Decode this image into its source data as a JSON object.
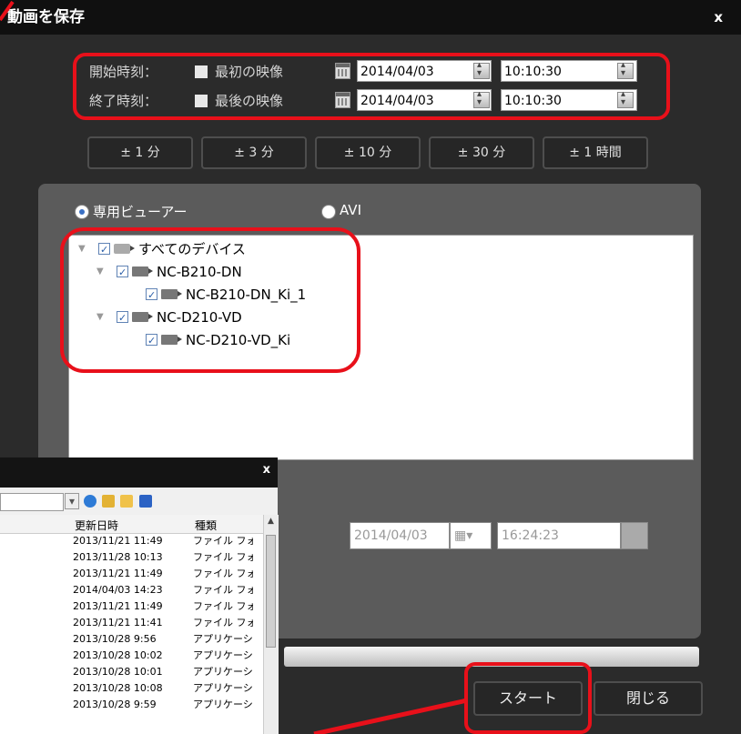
{
  "dialog": {
    "title": "動画を保存",
    "close": "x"
  },
  "time": {
    "start": {
      "label": "開始時刻：",
      "first_label": "最初の映像",
      "date": "2014/04/03",
      "time": "10:10:30"
    },
    "end": {
      "label": "終了時刻：",
      "last_label": "最後の映像",
      "date": "2014/04/03",
      "time": "10:10:30"
    }
  },
  "adjust_buttons": [
    "± 1 分",
    "± 3 分",
    "± 10 分",
    "± 30 分",
    "± 1 時間"
  ],
  "format": {
    "dedicated_viewer": "専用ビューアー",
    "avi": "AVI",
    "selected": "dedicated_viewer"
  },
  "tree": [
    {
      "label": "すべてのデバイス",
      "level": 0,
      "type": "disk",
      "expanded": true
    },
    {
      "label": "NC-B210-DN",
      "level": 1,
      "type": "camera",
      "expanded": true
    },
    {
      "label": "NC-B210-DN_Ki_1",
      "level": 2,
      "type": "camera"
    },
    {
      "label": "NC-D210-VD",
      "level": 1,
      "type": "camera",
      "expanded": true
    },
    {
      "label": "NC-D210-VD_Ki",
      "level": 2,
      "type": "camera"
    }
  ],
  "lower": {
    "date": "2014/04/03",
    "time": "16:24:23"
  },
  "buttons": {
    "start": "スタート",
    "close": "閉じる"
  },
  "file_window": {
    "close": "x",
    "columns": {
      "modified": "更新日時",
      "kind": "種類"
    },
    "rows": [
      {
        "date": "2013/11/21 11:49",
        "kind": "ファイル フォル"
      },
      {
        "date": "2013/11/28 10:13",
        "kind": "ファイル フォル"
      },
      {
        "date": "2013/11/21 11:49",
        "kind": "ファイル フォル"
      },
      {
        "date": "2014/04/03 14:23",
        "kind": "ファイル フォル"
      },
      {
        "date": "2013/11/21 11:49",
        "kind": "ファイル フォル"
      },
      {
        "date": "2013/11/21 11:41",
        "kind": "ファイル フォル"
      },
      {
        "date": "2013/10/28 9:56",
        "kind": "アプリケーショ"
      },
      {
        "date": "2013/10/28 10:02",
        "kind": "アプリケーショ"
      },
      {
        "date": "2013/10/28 10:01",
        "kind": "アプリケーショ"
      },
      {
        "date": "2013/10/28 10:08",
        "kind": "アプリケーショ"
      },
      {
        "date": "2013/10/28 9:59",
        "kind": "アプリケーショ"
      }
    ]
  },
  "colors": {
    "highlight": "#e8101a",
    "dialog_bg": "#2b2b2b",
    "panel_bg": "#5b5b5b"
  }
}
